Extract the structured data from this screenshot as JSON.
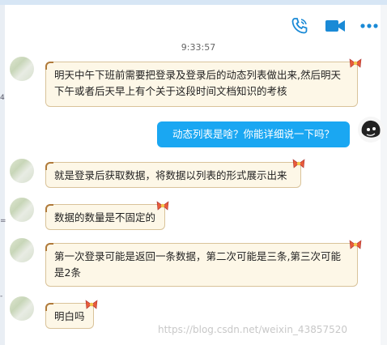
{
  "header": {
    "icons": [
      "phone-icon",
      "video-icon",
      "more-icon"
    ],
    "accent": "#1aa7f2"
  },
  "timestamp": "9:33:57",
  "messages": [
    {
      "side": "left",
      "text": "明天中午下班前需要把登录及登录后的动态列表做出来,然后明天下午或者后天早上有个关于这段时间文档知识的考核"
    },
    {
      "side": "right",
      "text": "动态列表是啥？你能详细说一下吗？"
    },
    {
      "side": "left",
      "text": "就是登录后获取数据，将数据以列表的形式展示出来"
    },
    {
      "side": "left",
      "text": "数据的数量是不固定的"
    },
    {
      "side": "left",
      "text": "第一次登录可能是返回一条数据，第二次可能是三条,第三次可能是2条"
    },
    {
      "side": "left",
      "text": "明白吗"
    }
  ],
  "watermark": "https://blog.csdn.net/weixin_43857520",
  "colors": {
    "bubble_bg": "#fdf7e7",
    "bubble_border": "#d9c39a",
    "sent_bg": "#1aa7f2"
  }
}
